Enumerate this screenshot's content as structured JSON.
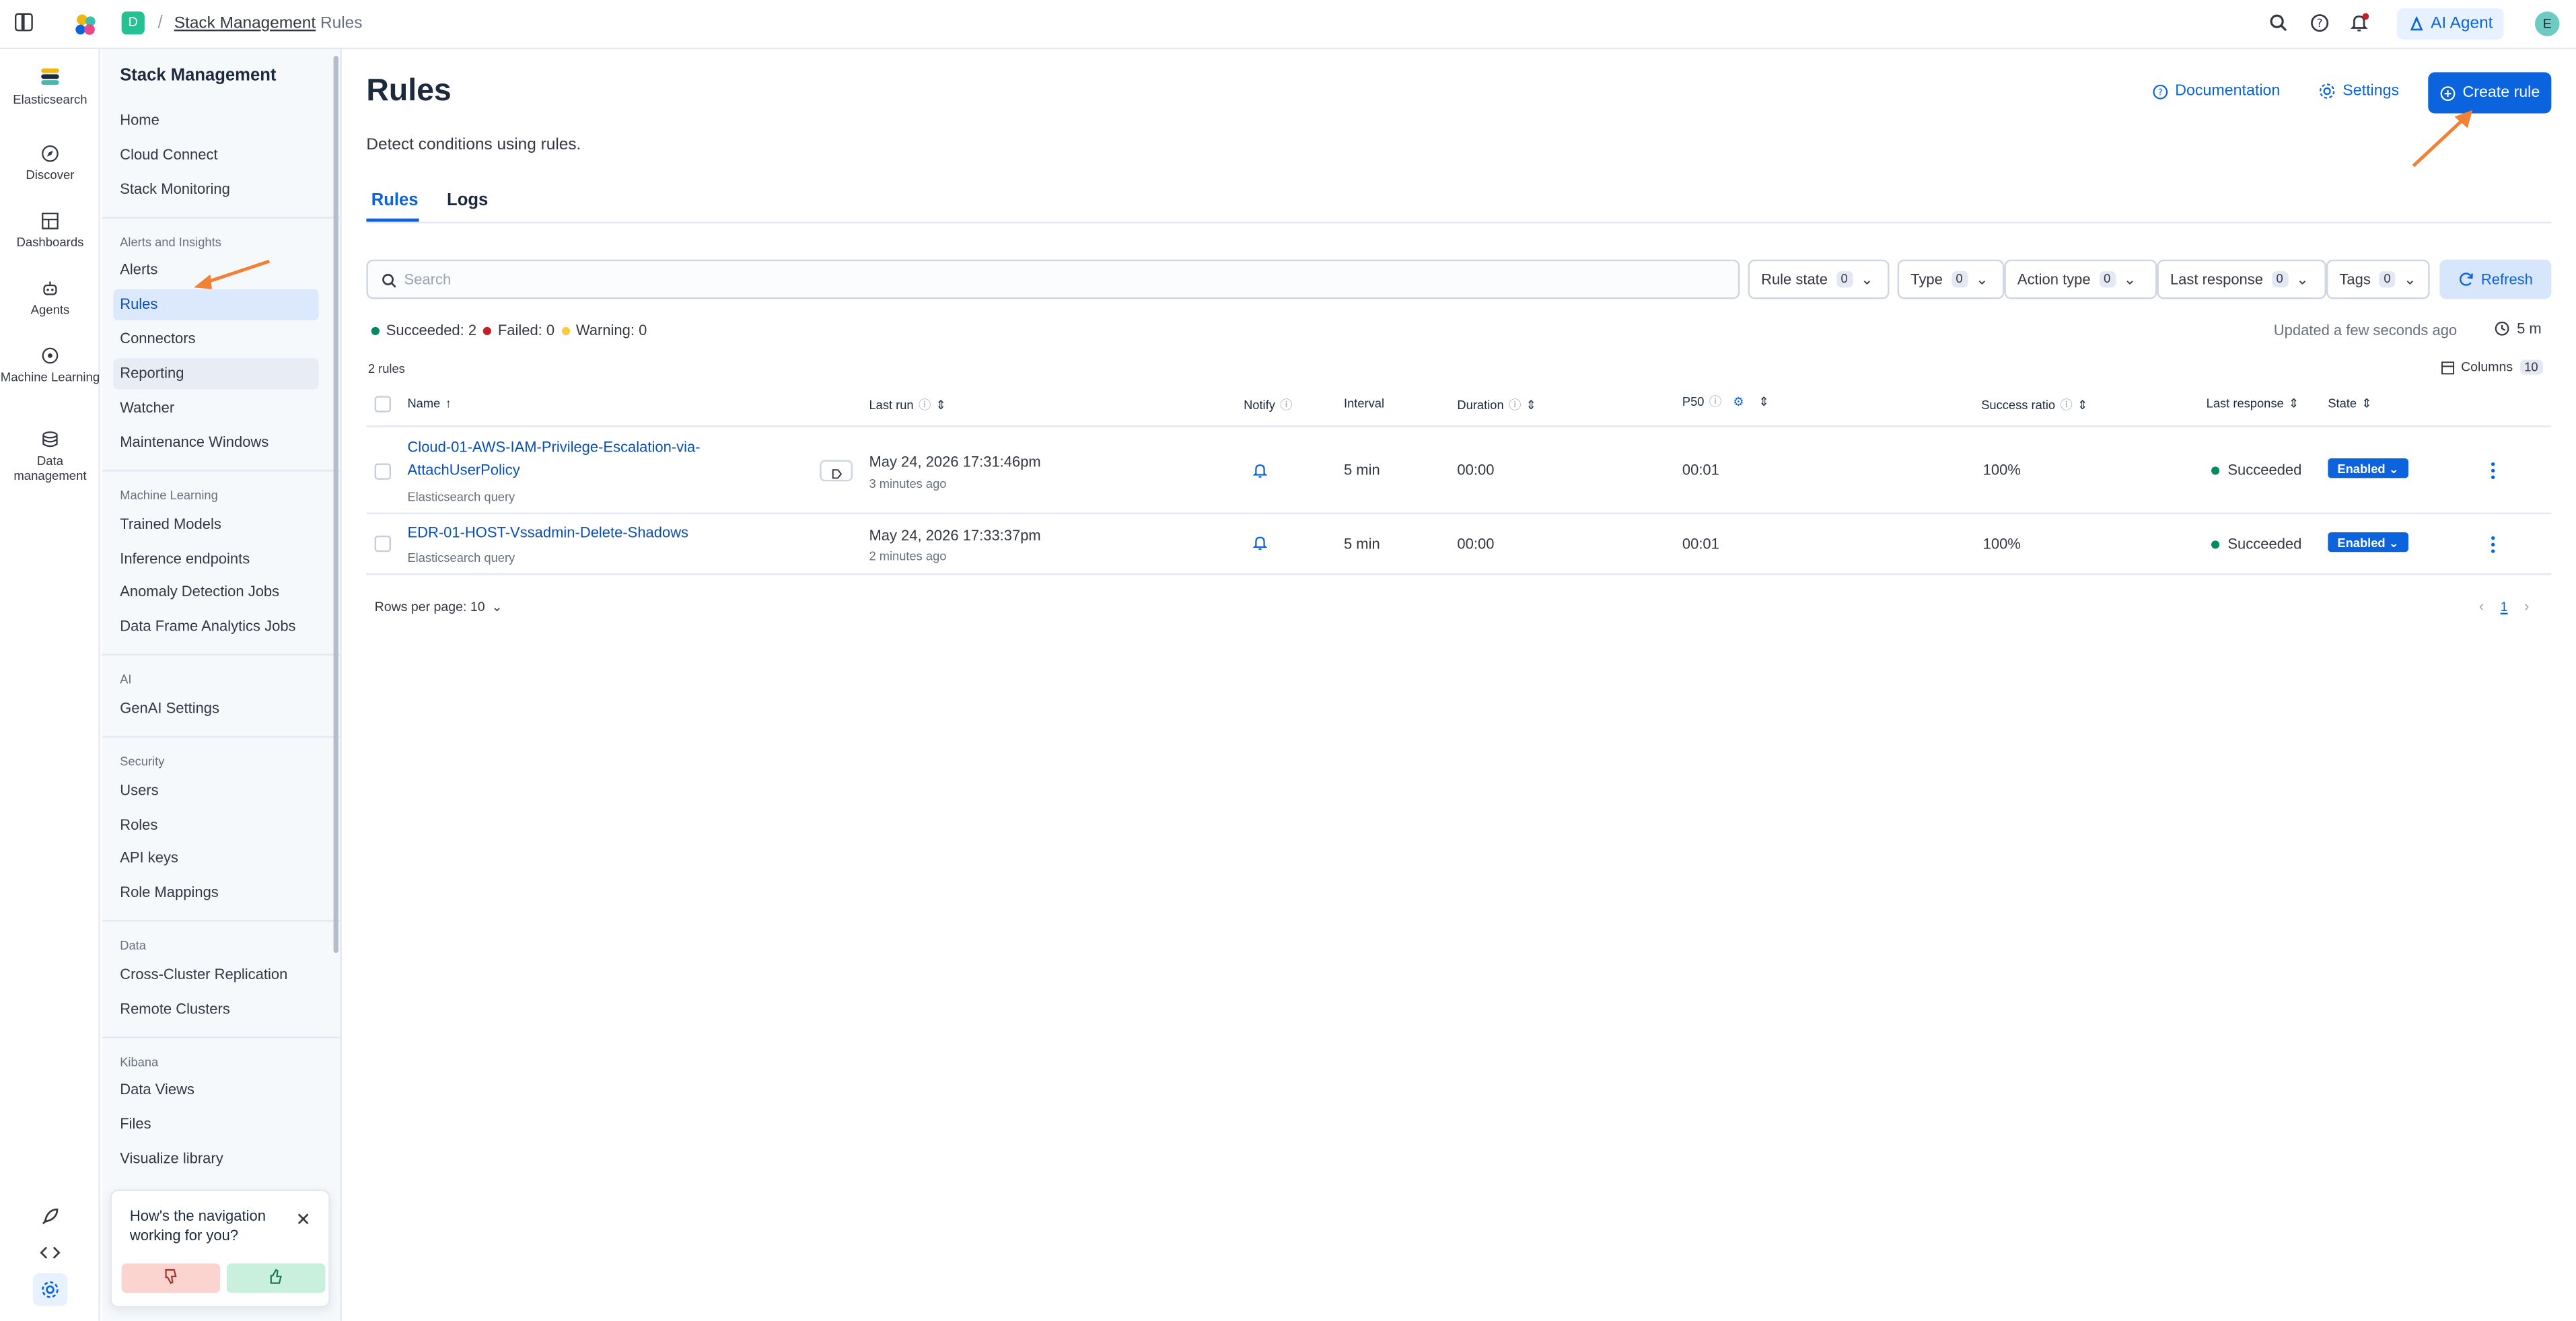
{
  "topbar": {
    "space_initial": "D",
    "breadcrumb_separator": "/",
    "breadcrumb_parent": "Stack Management",
    "breadcrumb_current": "Rules",
    "ai_agent_label": "AI Agent",
    "avatar_initial": "E"
  },
  "rail": {
    "items": [
      {
        "label": "Elasticsearch",
        "icon": "elasticsearch-logo-icon"
      },
      {
        "label": "Discover",
        "icon": "compass-icon"
      },
      {
        "label": "Dashboards",
        "icon": "dashboard-icon"
      },
      {
        "label": "Agents",
        "icon": "robot-icon"
      },
      {
        "label": "Machine Learning",
        "icon": "ml-icon"
      },
      {
        "label": "Data management",
        "icon": "database-icon"
      }
    ]
  },
  "sidenav": {
    "title": "Stack Management",
    "group1": [
      "Home",
      "Cloud Connect",
      "Stack Monitoring"
    ],
    "section_alerts": "Alerts and Insights",
    "alerts_items": [
      "Alerts",
      "Rules",
      "Connectors",
      "Reporting",
      "Watcher",
      "Maintenance Windows"
    ],
    "section_ml": "Machine Learning",
    "ml_items": [
      "Trained Models",
      "Inference endpoints",
      "Anomaly Detection Jobs",
      "Data Frame Analytics Jobs"
    ],
    "section_ai": "AI",
    "ai_items": [
      "GenAI Settings"
    ],
    "section_security": "Security",
    "security_items": [
      "Users",
      "Roles",
      "API keys",
      "Role Mappings"
    ],
    "section_data": "Data",
    "data_items": [
      "Cross-Cluster Replication",
      "Remote Clusters"
    ],
    "section_kibana": "Kibana",
    "kibana_items": [
      "Data Views",
      "Files",
      "Visualize library"
    ]
  },
  "feedback": {
    "question": "How's the navigation working for you?"
  },
  "header": {
    "title": "Rules",
    "description": "Detect conditions using rules.",
    "documentation": "Documentation",
    "settings": "Settings",
    "create_rule": "Create rule"
  },
  "tabs": [
    "Rules",
    "Logs"
  ],
  "filters": {
    "search_placeholder": "Search",
    "rule_state": "Rule state",
    "rule_state_count": "0",
    "type": "Type",
    "type_count": "0",
    "action_type": "Action type",
    "action_type_count": "0",
    "last_response": "Last response",
    "last_response_count": "0",
    "tags": "Tags",
    "tags_count": "0",
    "refresh": "Refresh"
  },
  "status": {
    "succeeded": "Succeeded: 2",
    "failed": "Failed: 0",
    "warning": "Warning: 0",
    "updated": "Updated a few seconds ago",
    "interval": "5 m",
    "rule_count": "2 rules",
    "columns_label": "Columns",
    "columns_count": "10"
  },
  "table": {
    "headers": {
      "name": "Name",
      "last_run": "Last run",
      "notify": "Notify",
      "interval": "Interval",
      "duration": "Duration",
      "p50": "P50",
      "success_ratio": "Success ratio",
      "last_response": "Last response",
      "state": "State"
    },
    "rows": [
      {
        "name_line1": "Cloud-01-AWS-IAM-Privilege-Escalation-via-",
        "name_line2": "AttachUserPolicy",
        "type": "Elasticsearch query",
        "last_run": "May 24, 2026 17:31:46pm",
        "last_run_relative": "3 minutes ago",
        "interval": "5 min",
        "duration": "00:00",
        "p50": "00:01",
        "success_ratio": "100%",
        "last_response": "Succeeded",
        "state": "Enabled"
      },
      {
        "name_line1": "EDR-01-HOST-Vssadmin-Delete-Shadows",
        "name_line2": "",
        "type": "Elasticsearch query",
        "last_run": "May 24, 2026 17:33:37pm",
        "last_run_relative": "2 minutes ago",
        "interval": "5 min",
        "duration": "00:00",
        "p50": "00:01",
        "success_ratio": "100%",
        "last_response": "Succeeded",
        "state": "Enabled"
      }
    ]
  },
  "pagination": {
    "rows_per_page": "Rows per page: 10",
    "current_page": "1"
  },
  "colors": {
    "primary": "#0b64dd",
    "success": "#008a5e",
    "danger": "#c61e25",
    "warning": "#facb3d",
    "annotation_arrow": "#f28035"
  }
}
